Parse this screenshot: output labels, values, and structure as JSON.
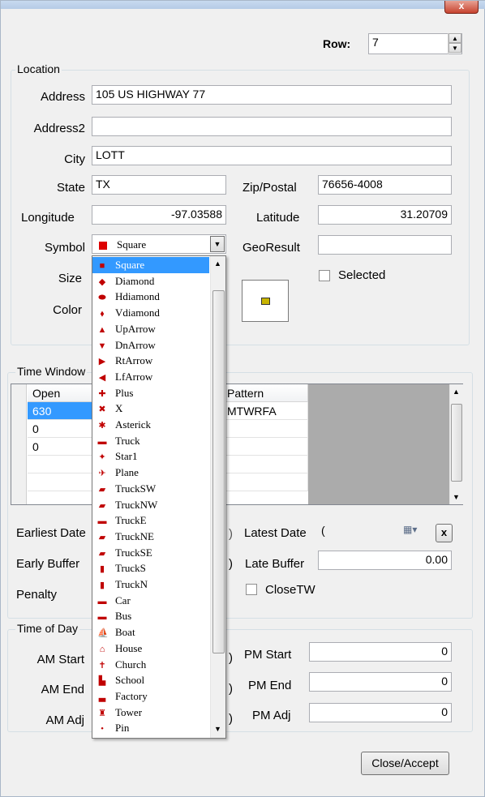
{
  "window": {
    "close_label": "x"
  },
  "row": {
    "label": "Row:",
    "value": "7"
  },
  "location": {
    "title": "Location",
    "address_label": "Address",
    "address": "105 US HIGHWAY 77",
    "address2_label": "Address2",
    "address2": "",
    "city_label": "City",
    "city": "LOTT",
    "state_label": "State",
    "state": "TX",
    "zip_label": "Zip/Postal",
    "zip": "76656-4008",
    "longitude_label": "Longitude",
    "longitude": "-97.03588",
    "latitude_label": "Latitude",
    "latitude": "31.20709",
    "symbol_label": "Symbol",
    "symbol_selected": "Square",
    "georesult_label": "GeoResult",
    "georesult": "",
    "size_label": "Size",
    "selected_label": "Selected",
    "color_label": "Color",
    "swatch_color": "#c8b400"
  },
  "symbol_options": [
    {
      "label": "Square",
      "icon": "square-icon",
      "glyph": "■"
    },
    {
      "label": "Diamond",
      "icon": "diamond-icon",
      "glyph": "◆"
    },
    {
      "label": "Hdiamond",
      "icon": "hdiamond-icon",
      "glyph": "⬬"
    },
    {
      "label": "Vdiamond",
      "icon": "vdiamond-icon",
      "glyph": "⬧"
    },
    {
      "label": "UpArrow",
      "icon": "up-arrow-icon",
      "glyph": "▲"
    },
    {
      "label": "DnArrow",
      "icon": "down-arrow-icon",
      "glyph": "▼"
    },
    {
      "label": "RtArrow",
      "icon": "right-arrow-icon",
      "glyph": "▶"
    },
    {
      "label": "LfArrow",
      "icon": "left-arrow-icon",
      "glyph": "◀"
    },
    {
      "label": "Plus",
      "icon": "plus-icon",
      "glyph": "✚"
    },
    {
      "label": "X",
      "icon": "x-icon",
      "glyph": "✖"
    },
    {
      "label": "Asterick",
      "icon": "asterisk-icon",
      "glyph": "✱"
    },
    {
      "label": "Truck",
      "icon": "truck-icon",
      "glyph": "▬"
    },
    {
      "label": "Star1",
      "icon": "star-icon",
      "glyph": "✦"
    },
    {
      "label": "Plane",
      "icon": "plane-icon",
      "glyph": "✈"
    },
    {
      "label": "TruckSW",
      "icon": "truck-sw-icon",
      "glyph": "▰"
    },
    {
      "label": "TruckNW",
      "icon": "truck-nw-icon",
      "glyph": "▰"
    },
    {
      "label": "TruckE",
      "icon": "truck-e-icon",
      "glyph": "▬"
    },
    {
      "label": "TruckNE",
      "icon": "truck-ne-icon",
      "glyph": "▰"
    },
    {
      "label": "TruckSE",
      "icon": "truck-se-icon",
      "glyph": "▰"
    },
    {
      "label": "TruckS",
      "icon": "truck-s-icon",
      "glyph": "▮"
    },
    {
      "label": "TruckN",
      "icon": "truck-n-icon",
      "glyph": "▮"
    },
    {
      "label": "Car",
      "icon": "car-icon",
      "glyph": "▬"
    },
    {
      "label": "Bus",
      "icon": "bus-icon",
      "glyph": "▬"
    },
    {
      "label": "Boat",
      "icon": "boat-icon",
      "glyph": "⛵"
    },
    {
      "label": "House",
      "icon": "house-icon",
      "glyph": "⌂"
    },
    {
      "label": "Church",
      "icon": "church-icon",
      "glyph": "✝"
    },
    {
      "label": "School",
      "icon": "school-icon",
      "glyph": "▙"
    },
    {
      "label": "Factory",
      "icon": "factory-icon",
      "glyph": "▃"
    },
    {
      "label": "Tower",
      "icon": "tower-icon",
      "glyph": "♜"
    },
    {
      "label": "Pin",
      "icon": "pin-icon",
      "glyph": "•"
    }
  ],
  "time_windows": {
    "title": "Time Window",
    "columns": [
      "Open",
      "Pattern"
    ],
    "rows": [
      {
        "open": "630",
        "pattern": "MTWRFA"
      },
      {
        "open": "0",
        "pattern": ""
      },
      {
        "open": "0",
        "pattern": ""
      },
      {
        "open": "",
        "pattern": ""
      },
      {
        "open": "",
        "pattern": ""
      }
    ],
    "earliest_date_label": "Earliest Date",
    "latest_date_label": "Latest Date",
    "latest_date": "(",
    "clear_label": "x",
    "early_buffer_label": "Early Buffer",
    "late_buffer_label": "Late Buffer",
    "late_buffer": "0.00",
    "penalty_label": "Penalty",
    "closetw_label": "CloseTW",
    "hidden_digit_1": ")",
    "hidden_digit_2": ")"
  },
  "time_of_day": {
    "title": "Time of Day",
    "am_start_label": "AM Start",
    "pm_start_label": "PM Start",
    "pm_start": "0",
    "am_end_label": "AM End",
    "pm_end_label": "PM End",
    "pm_end": "0",
    "am_adj_label": "AM Adj",
    "pm_adj_label": "PM Adj",
    "pm_adj": "0",
    "hidden_digit_1": ")",
    "hidden_digit_2": ")",
    "hidden_digit_3": ")"
  },
  "footer": {
    "close_accept_label": "Close/Accept"
  }
}
